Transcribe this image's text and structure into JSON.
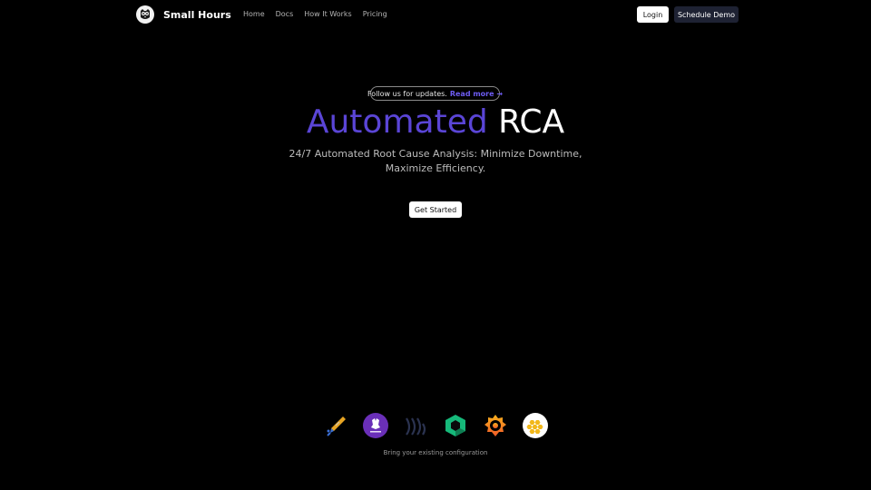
{
  "nav": {
    "brand": "Small Hours",
    "links": [
      "Home",
      "Docs",
      "How It Works",
      "Pricing"
    ],
    "login_label": "Login",
    "demo_label": "Schedule Demo"
  },
  "hero": {
    "follow_text": "Follow us for updates.",
    "follow_link": "Read more →",
    "title_accent": "Automated",
    "title_rest": "RCA",
    "subtitle": "24/7 Automated Root Cause Analysis: Minimize Downtime, Maximize Efficiency.",
    "cta_label": "Get Started"
  },
  "integrations": {
    "icons": [
      "feather-pen-icon",
      "prometheus-icon",
      "signal-waves-icon",
      "hexagon-icon",
      "grafana-icon",
      "honeycomb-icon"
    ],
    "caption": "Bring your existing configuration"
  },
  "colors": {
    "background": "#000000",
    "accent": "#5a45d6",
    "link": "#6d5cf2",
    "demo_button": "#1e2233"
  }
}
